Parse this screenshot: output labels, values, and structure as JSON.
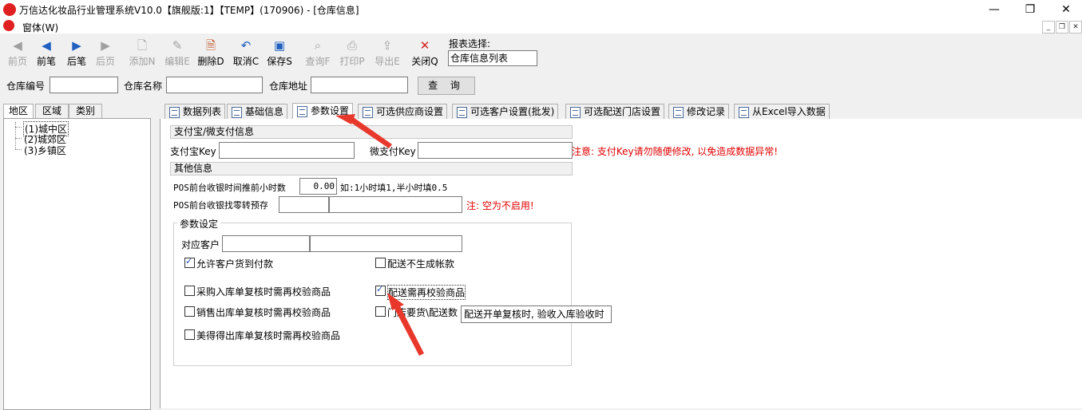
{
  "window": {
    "title": "万信达化妆品行业管理系统V10.0【旗舰版:1】【TEMP】(170906) - [仓库信息]",
    "minimize": "—",
    "maximize": "❐",
    "close": "✕"
  },
  "menu": {
    "window_menu": "窗体(W)"
  },
  "toolbar": {
    "buttons": [
      {
        "label": "前页",
        "icon": "first-page-icon",
        "enabled": false
      },
      {
        "label": "前笔",
        "icon": "prev-icon",
        "enabled": true
      },
      {
        "label": "后笔",
        "icon": "next-icon",
        "enabled": true
      },
      {
        "label": "后页",
        "icon": "last-page-icon",
        "enabled": false
      },
      {
        "label": "添加N",
        "icon": "add-icon",
        "enabled": false
      },
      {
        "label": "编辑E",
        "icon": "edit-icon",
        "enabled": false
      },
      {
        "label": "删除D",
        "icon": "delete-icon",
        "enabled": true
      },
      {
        "label": "取消C",
        "icon": "undo-icon",
        "enabled": true
      },
      {
        "label": "保存S",
        "icon": "save-icon",
        "enabled": true
      },
      {
        "label": "查询F",
        "icon": "query-icon",
        "enabled": false
      },
      {
        "label": "打印P",
        "icon": "print-icon",
        "enabled": false
      },
      {
        "label": "导出E",
        "icon": "export-icon",
        "enabled": false
      },
      {
        "label": "关闭Q",
        "icon": "close-icon",
        "enabled": true
      }
    ],
    "report_label": "报表选择:",
    "report_value": "仓库信息列表"
  },
  "search": {
    "code_label": "仓库编号",
    "name_label": "仓库名称",
    "address_label": "仓库地址",
    "button": "查 询"
  },
  "left_tabs": [
    "地区",
    "区域",
    "类别"
  ],
  "tree": [
    "(1)城中区",
    "(2)城郊区",
    "(3)乡镇区"
  ],
  "tabs": [
    "数据列表",
    "基础信息",
    "参数设置",
    "可选供应商设置",
    "可选客户设置(批发)",
    "可选配送门店设置",
    "修改记录",
    "从Excel导入数据"
  ],
  "params": {
    "pay_section": "支付宝/微支付信息",
    "alipay_key_label": "支付宝Key",
    "wechat_key_label": "微支付Key",
    "key_warning": "注意: 支付Key请勿随便修改, 以免造成数据异常!",
    "other_section": "其他信息",
    "pos_hours_label": "POS前台收银时间推前小时数",
    "pos_hours_value": "0.00",
    "pos_hours_hint": "如:1小时填1,半小时填0.5",
    "pos_change_label": "POS前台收银找零转预存",
    "pos_change_note": "注: 空为不启用!",
    "group_title": "参数设定",
    "customer_label": "对应客户",
    "checkboxes": [
      {
        "label": "允许客户货到付款",
        "checked": true
      },
      {
        "label": "配送不生成帐款",
        "checked": false
      },
      {
        "label": "采购入库单复核时需再校验商品",
        "checked": false
      },
      {
        "label": "配送需再校验商品",
        "checked": true
      },
      {
        "label": "销售出库单复核时需再校验商品",
        "checked": false
      },
      {
        "label": "门店要货\\配送数",
        "checked": false
      },
      {
        "label": "美得得出库单复核时需再校验商品",
        "checked": false
      }
    ],
    "tooltip": "配送开单复核时, 验收入库验收时"
  }
}
